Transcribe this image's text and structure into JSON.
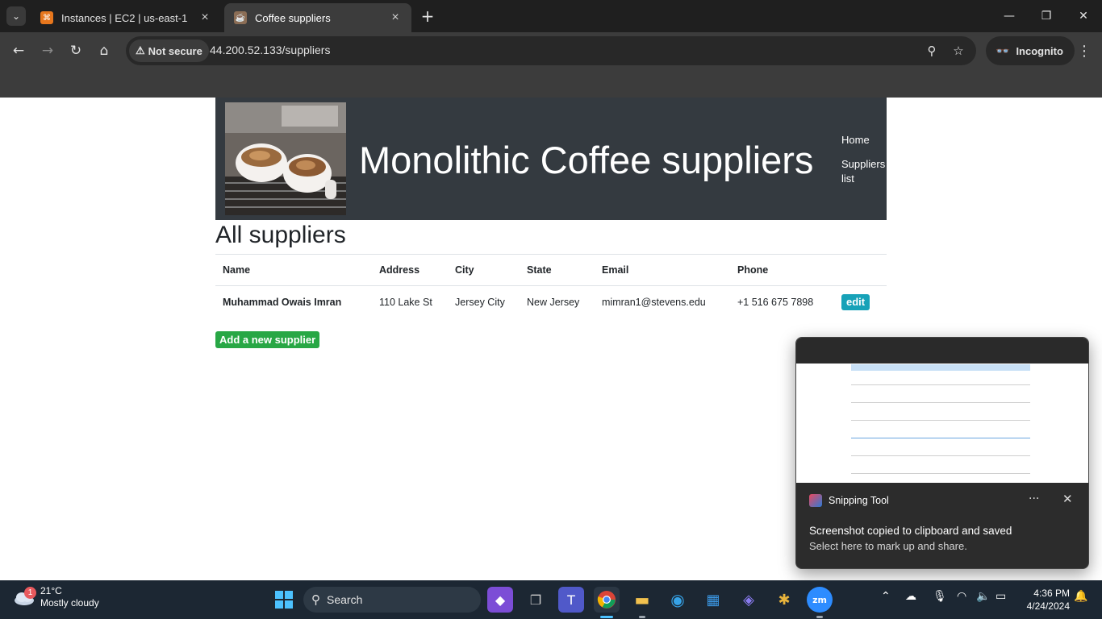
{
  "browser": {
    "tabs": [
      {
        "title": "Instances | EC2 | us-east-1",
        "active": false
      },
      {
        "title": "Coffee suppliers",
        "active": true
      }
    ],
    "security_chip": "Not secure",
    "url": "44.200.52.133/suppliers",
    "profile_label": "Incognito"
  },
  "site": {
    "title": "Monolithic Coffee suppliers",
    "nav": [
      "Home",
      "Suppliers list"
    ]
  },
  "content": {
    "heading": "All suppliers",
    "columns": [
      "Name",
      "Address",
      "City",
      "State",
      "Email",
      "Phone"
    ],
    "rows": [
      {
        "name": "Muhammad Owais Imran",
        "address": "110 Lake St",
        "city": "Jersey City",
        "state": "New Jersey",
        "email": "mimran1@stevens.edu",
        "phone": "+1 516 675 7898",
        "action": "edit"
      }
    ],
    "add_button": "Add a new supplier"
  },
  "toast": {
    "app": "Snipping Tool",
    "message": "Screenshot copied to clipboard and saved",
    "sub": "Select here to mark up and share."
  },
  "taskbar": {
    "weather_temp": "21°C",
    "weather_desc": "Mostly cloudy",
    "weather_badge": "1",
    "search_label": "Search",
    "time": "4:36 PM",
    "date": "4/24/2024"
  },
  "colors": {
    "header_bg": "#343a40",
    "edit_btn": "#17a2b8",
    "add_btn": "#28a745"
  }
}
